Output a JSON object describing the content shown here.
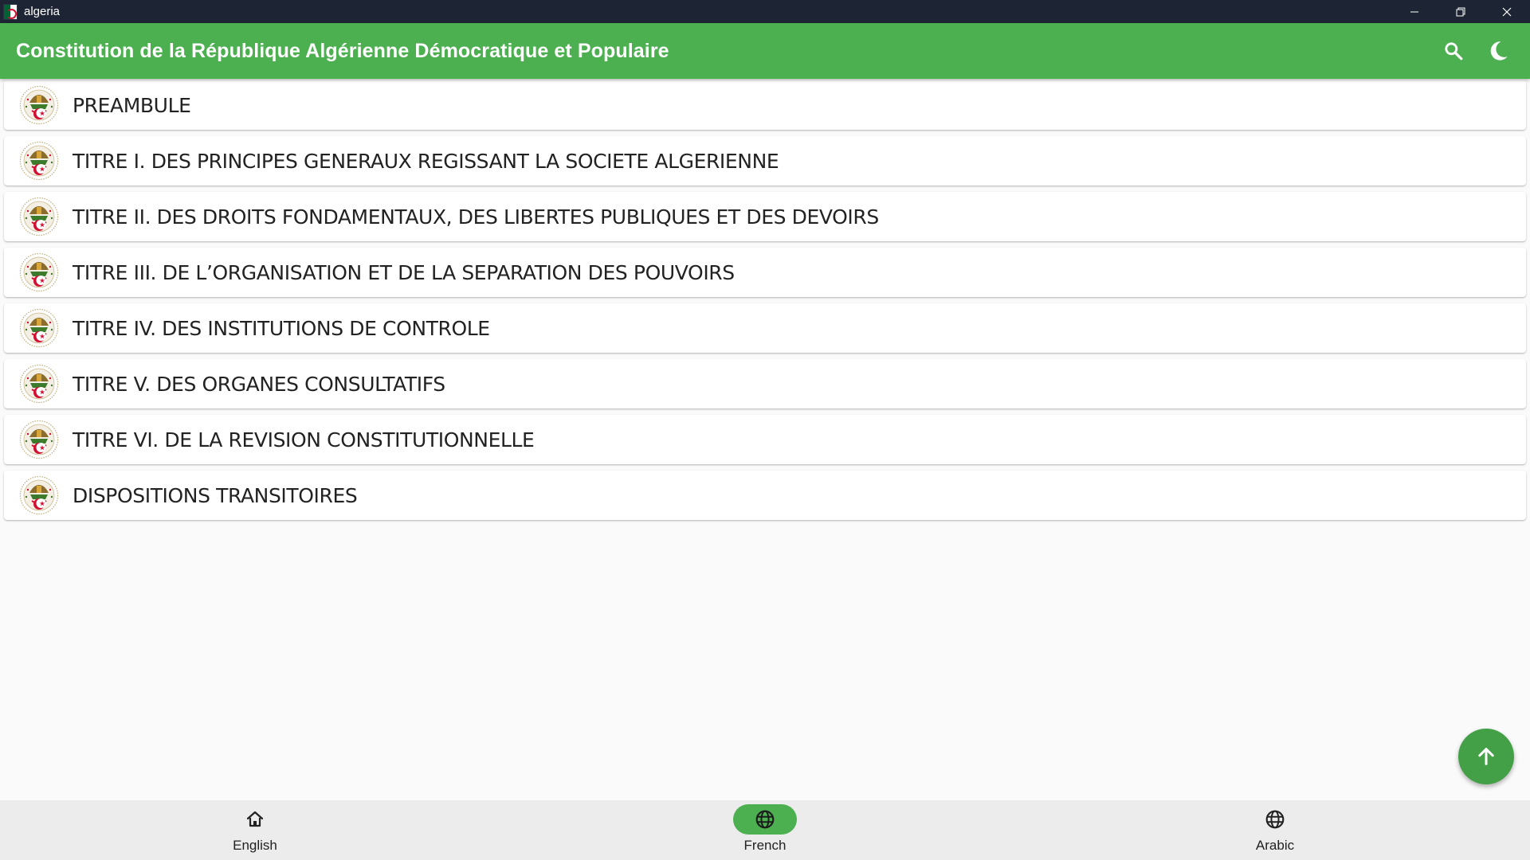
{
  "window": {
    "title": "algeria",
    "controls": {
      "minimize_icon": "minimize-icon",
      "restore_icon": "restore-icon",
      "close_icon": "close-icon"
    }
  },
  "appbar": {
    "title": "Constitution de la République Algérienne Démocratique et Populaire",
    "background": "#4caf50",
    "actions": [
      "search-icon",
      "dark-mode-icon"
    ]
  },
  "list": {
    "items": [
      {
        "label": "PREAMBULE",
        "icon": "algeria-emblem-icon"
      },
      {
        "label": "TITRE I. DES PRINCIPES GENERAUX REGISSANT LA SOCIETE ALGERIENNE",
        "icon": "algeria-emblem-icon"
      },
      {
        "label": "TITRE II. DES DROITS FONDAMENTAUX, DES LIBERTES PUBLIQUES ET DES DEVOIRS",
        "icon": "algeria-emblem-icon"
      },
      {
        "label": "TITRE III. DE L’ORGANISATION ET DE LA SEPARATION DES POUVOIRS",
        "icon": "algeria-emblem-icon"
      },
      {
        "label": "TITRE IV. DES INSTITUTIONS DE CONTROLE",
        "icon": "algeria-emblem-icon"
      },
      {
        "label": "TITRE V. DES ORGANES CONSULTATIFS",
        "icon": "algeria-emblem-icon"
      },
      {
        "label": "TITRE VI. DE LA REVISION CONSTITUTIONNELLE",
        "icon": "algeria-emblem-icon"
      },
      {
        "label": "DISPOSITIONS TRANSITOIRES",
        "icon": "algeria-emblem-icon"
      }
    ]
  },
  "fab": {
    "icon": "arrow-up-icon",
    "color": "#43a047"
  },
  "bottom_nav": {
    "items": [
      {
        "label": "English",
        "icon": "home-icon",
        "active": false
      },
      {
        "label": "French",
        "icon": "globe-icon",
        "active": true
      },
      {
        "label": "Arabic",
        "icon": "globe-icon",
        "active": false
      }
    ]
  }
}
